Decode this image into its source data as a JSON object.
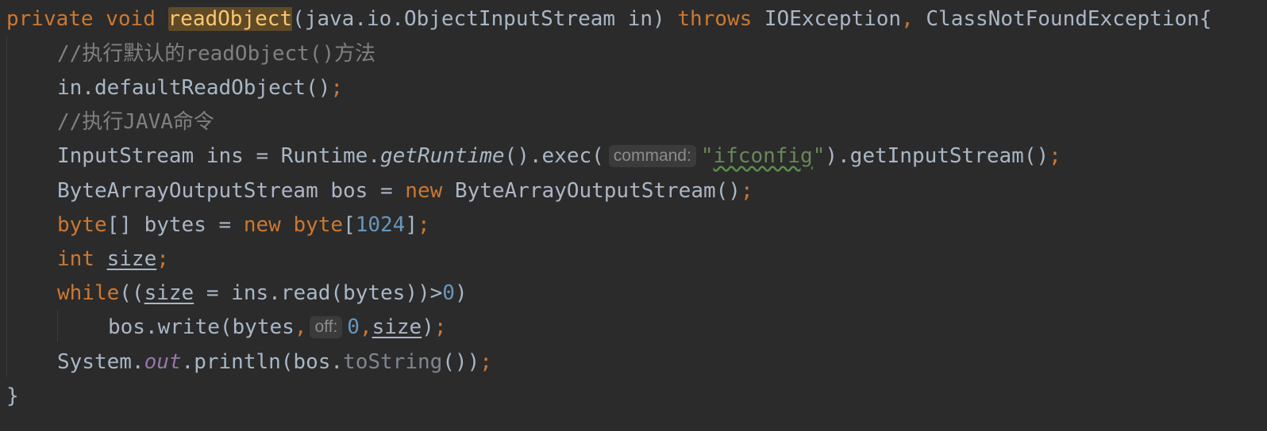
{
  "code": {
    "line1": {
      "mod": "private",
      "ret": "void",
      "method": "readObject",
      "params": "(java.io.ObjectInputStream in) ",
      "throws": "throws",
      "exc1": " IOException",
      "comma": ",",
      "exc2": " ClassNotFoundException{"
    },
    "line2": {
      "comment": "//执行默认的readObject()方法"
    },
    "line3": {
      "call": "in.defaultReadObject()",
      "semi": ";"
    },
    "line4": {
      "comment": "//执行JAVA命令"
    },
    "line5": {
      "a": "InputStream ins = Runtime.",
      "b": "getRuntime",
      "c": "().exec(",
      "hint": "command:",
      "q1": "\"",
      "strval": "ifconfig",
      "q2": "\"",
      "d": ").getInputStream()",
      "semi": ";"
    },
    "line6": {
      "a": "ByteArrayOutputStream bos = ",
      "new": "new",
      "b": " ByteArrayOutputStream()",
      "semi": ";"
    },
    "line7": {
      "kw1": "byte",
      "a": "[] bytes = ",
      "kw2": "new",
      "sp": " ",
      "kw3": "byte",
      "b": "[",
      "num": "1024",
      "c": "]",
      "semi": ";"
    },
    "line8": {
      "kw": "int",
      "sp": " ",
      "var": "size",
      "semi": ";"
    },
    "line9": {
      "kw": "while",
      "a": "((",
      "var": "size",
      "b": " = ins.read(bytes))>",
      "num": "0",
      "c": ")"
    },
    "line10": {
      "a": "bos.write(bytes",
      "comma": ",",
      "hint": "off:",
      "num": "0",
      "comma2": ",",
      "var": "size",
      "b": ")",
      "semi": ";"
    },
    "line11": {
      "a": "System.",
      "field": "out",
      "b": ".println(bos.",
      "dim": "toString",
      "c": "())",
      "semi": ";"
    },
    "line12": {
      "brace": "}"
    }
  },
  "colors": {
    "background": "#2b2b2b",
    "keyword": "#cc7832",
    "number": "#6897bb",
    "string": "#6a8759",
    "comment": "#808080",
    "method_highlight": "#ffc66d",
    "static_field": "#9876aa"
  }
}
